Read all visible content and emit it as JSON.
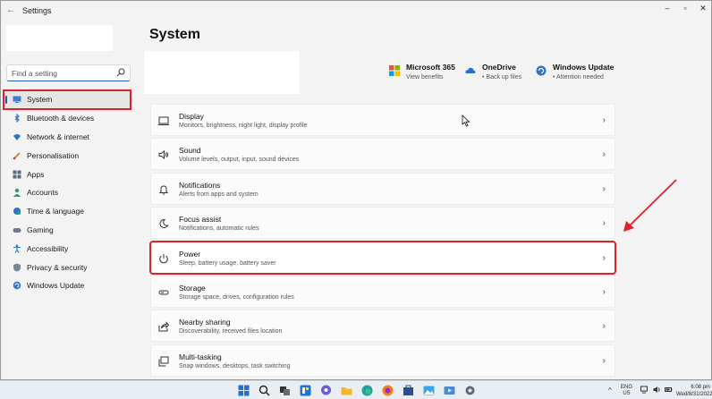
{
  "window": {
    "title": "Settings",
    "back_icon": "arrow-left-icon",
    "controls": [
      "minimize-icon",
      "maximize-icon",
      "close-icon"
    ]
  },
  "search": {
    "placeholder": "Find a setting",
    "icon": "search-icon"
  },
  "nav": {
    "items": [
      {
        "label": "System",
        "icon": "monitor-icon",
        "selected": true
      },
      {
        "label": "Bluetooth & devices",
        "icon": "bluetooth-icon"
      },
      {
        "label": "Network & internet",
        "icon": "wifi-icon"
      },
      {
        "label": "Personalisation",
        "icon": "brush-icon"
      },
      {
        "label": "Apps",
        "icon": "apps-icon"
      },
      {
        "label": "Accounts",
        "icon": "person-icon"
      },
      {
        "label": "Time & language",
        "icon": "globe-clock-icon"
      },
      {
        "label": "Gaming",
        "icon": "gamepad-icon"
      },
      {
        "label": "Accessibility",
        "icon": "accessibility-icon"
      },
      {
        "label": "Privacy & security",
        "icon": "shield-icon"
      },
      {
        "label": "Windows Update",
        "icon": "update-icon"
      }
    ]
  },
  "main": {
    "title": "System",
    "quick_links": [
      {
        "title": "Microsoft 365",
        "subtitle": "View benefits",
        "icon": "microsoft-logo-icon"
      },
      {
        "title": "OneDrive",
        "subtitle": "• Back up files",
        "icon": "cloud-icon"
      },
      {
        "title": "Windows Update",
        "subtitle": "• Attention needed",
        "icon": "update-icon"
      }
    ],
    "rows": [
      {
        "title": "Display",
        "subtitle": "Monitors, brightness, night light, display profile",
        "icon": "display-icon"
      },
      {
        "title": "Sound",
        "subtitle": "Volume levels, output, input, sound devices",
        "icon": "speaker-icon"
      },
      {
        "title": "Notifications",
        "subtitle": "Alerts from apps and system",
        "icon": "bell-icon"
      },
      {
        "title": "Focus assist",
        "subtitle": "Notifications, automatic rules",
        "icon": "moon-icon"
      },
      {
        "title": "Power",
        "subtitle": "Sleep, battery usage, battery saver",
        "icon": "power-icon",
        "highlighted": true
      },
      {
        "title": "Storage",
        "subtitle": "Storage space, drives, configuration rules",
        "icon": "storage-icon"
      },
      {
        "title": "Nearby sharing",
        "subtitle": "Discoverability, received files location",
        "icon": "share-icon"
      },
      {
        "title": "Multi-tasking",
        "subtitle": "Snap windows, desktops, task switching",
        "icon": "multitask-icon"
      }
    ],
    "chevron": "›"
  },
  "taskbar": {
    "language": "ENG",
    "region": "US",
    "time": "6:08 pm",
    "date": "Wed/8/31/2022"
  },
  "colors": {
    "accent": "#1a5fb4",
    "highlight_box": "#e0212b",
    "background": "#f3f3f3",
    "card": "#fbfbfb"
  }
}
